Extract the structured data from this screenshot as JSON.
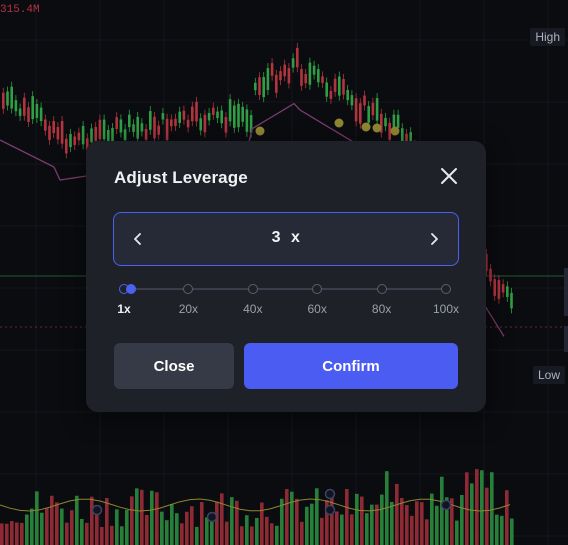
{
  "chart": {
    "volume_label": "315.4M",
    "high_label": "High",
    "low_label": "Low"
  },
  "dialog": {
    "title": "Adjust Leverage",
    "leverage_value": "3",
    "leverage_unit": "x",
    "slider": {
      "ticks": [
        "1x",
        "20x",
        "40x",
        "60x",
        "80x",
        "100x"
      ],
      "min": 1,
      "max": 100,
      "value": 3,
      "active_tick_index": 0
    },
    "close_label": "Close",
    "confirm_label": "Confirm"
  },
  "colors": {
    "accent": "#4a5cf2",
    "bull": "#2f9e44",
    "bear": "#b2343f",
    "dialog_bg": "#1f2128"
  },
  "icons": {
    "close": "close-icon",
    "decrement": "chevron-left-icon",
    "increment": "chevron-right-icon"
  }
}
